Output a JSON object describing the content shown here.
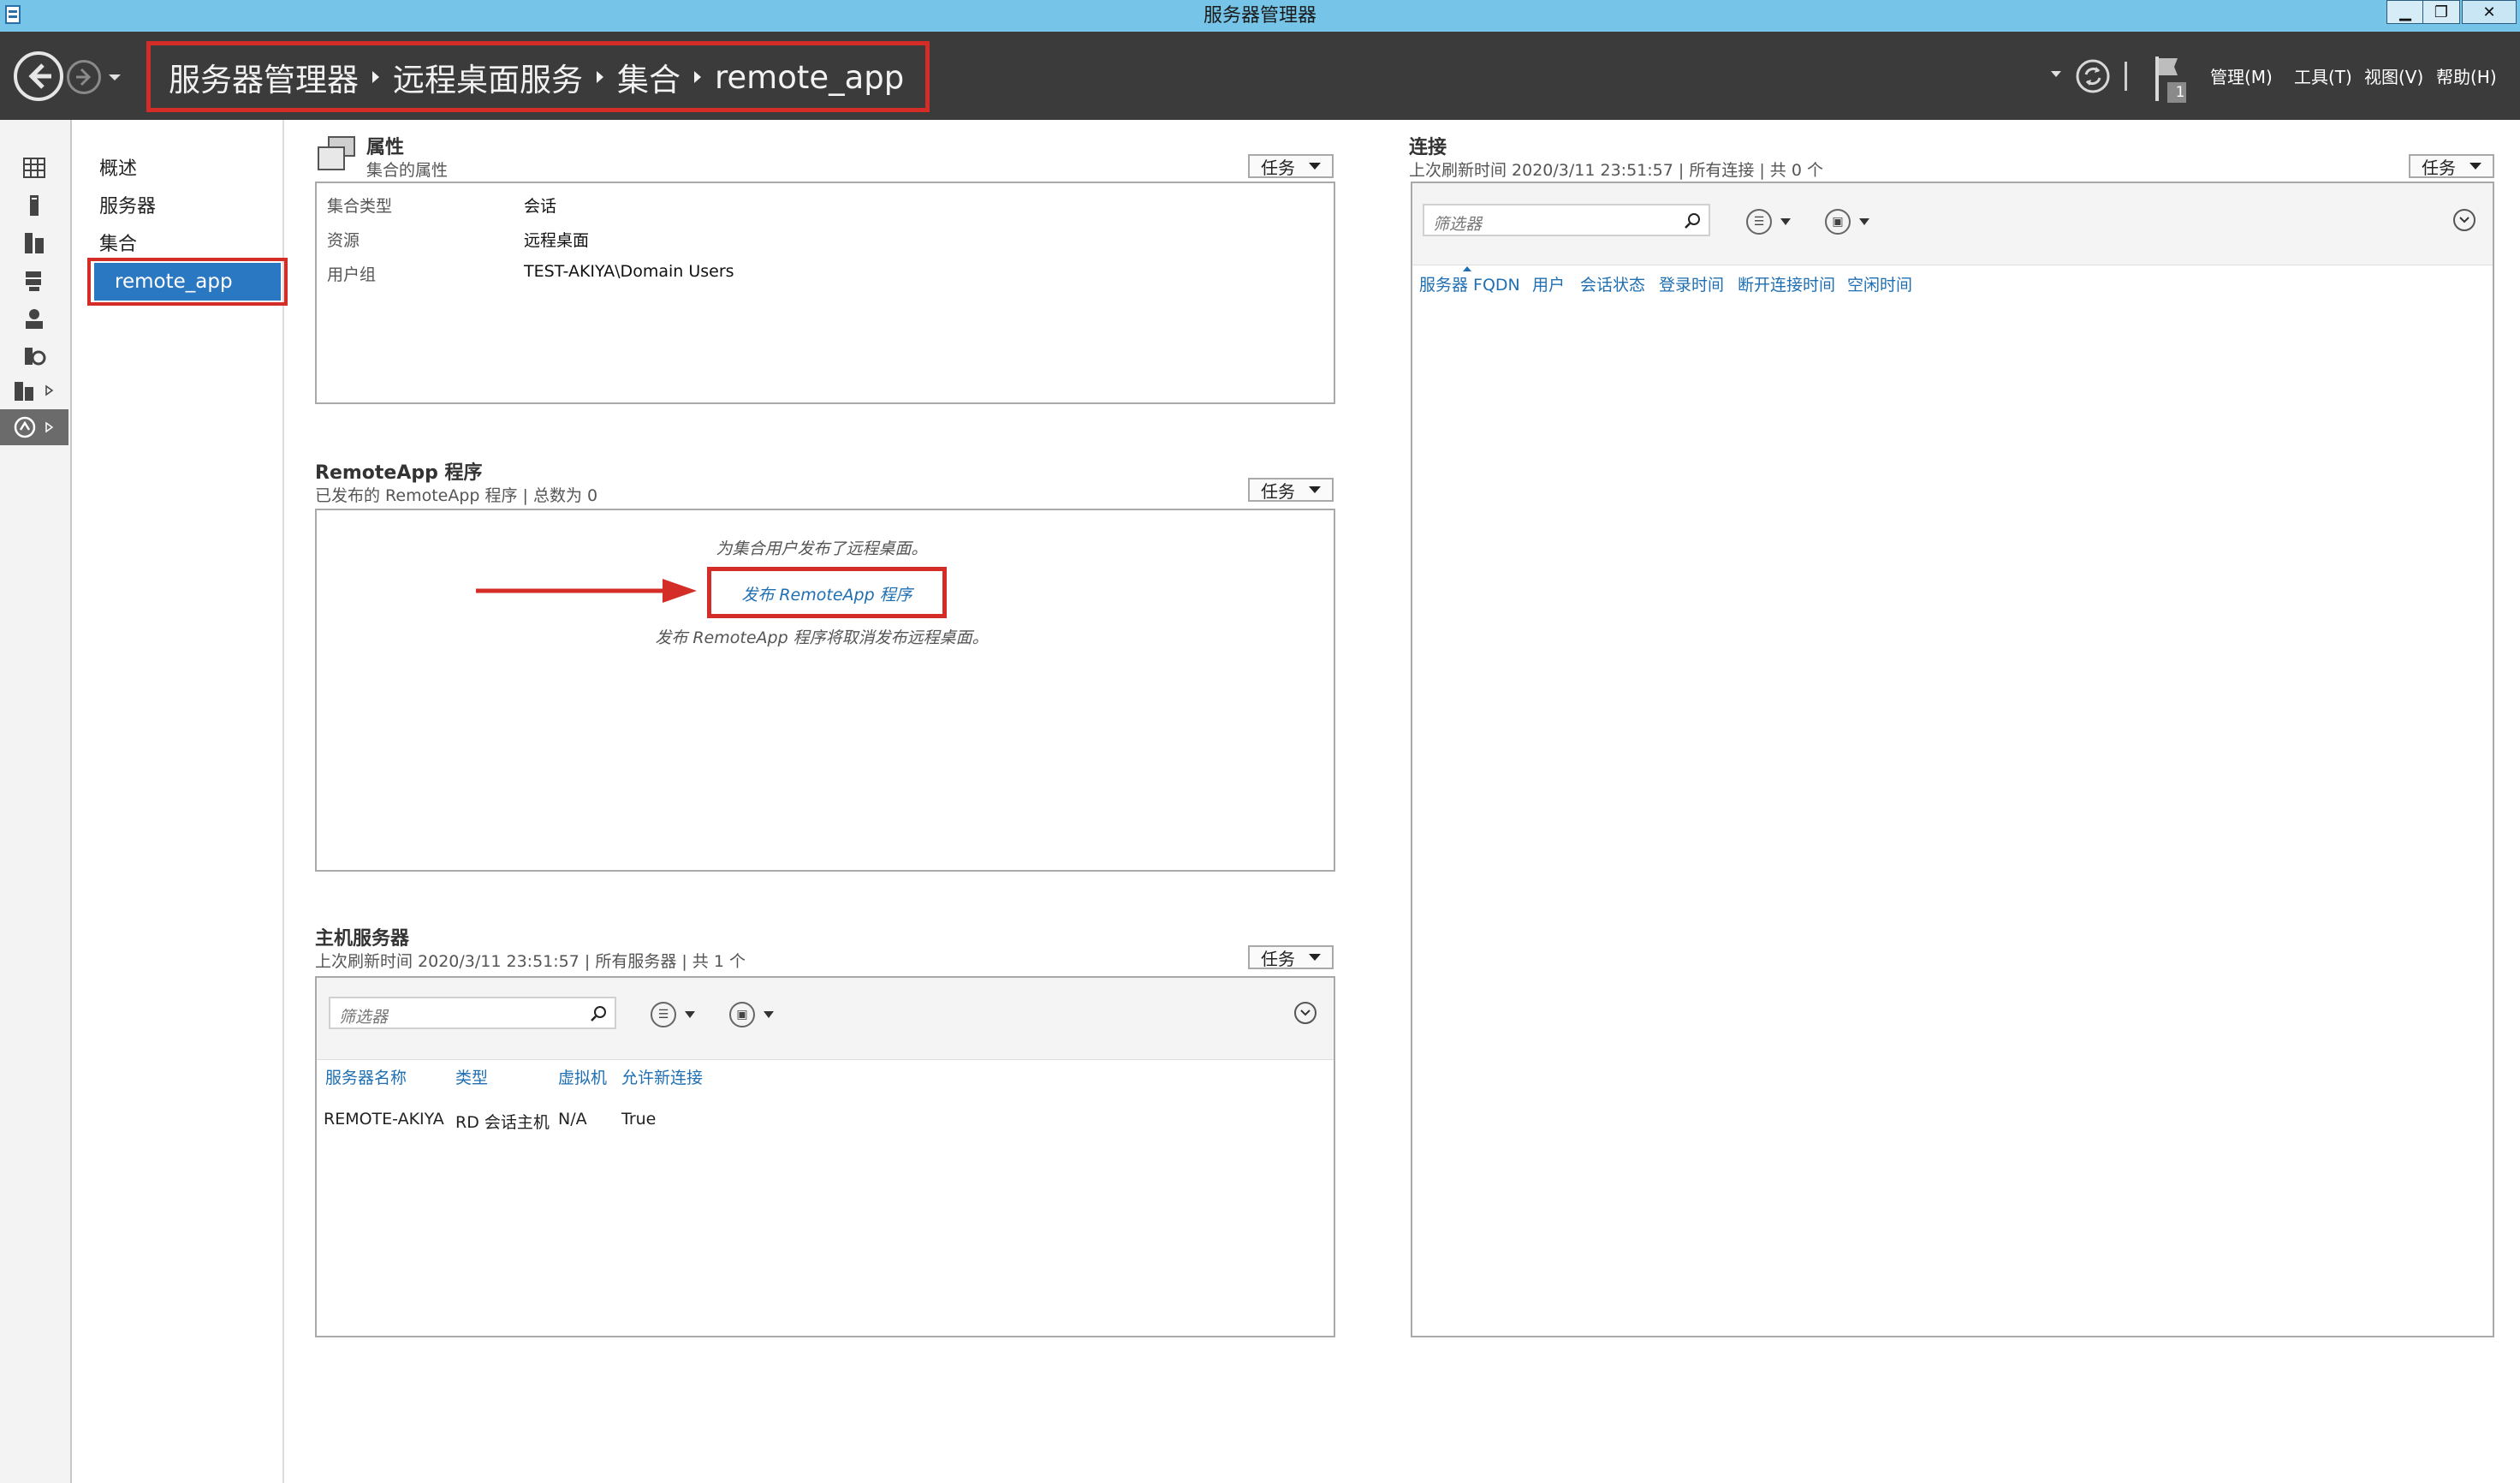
{
  "window": {
    "title": "服务器管理器"
  },
  "breadcrumb": [
    "服务器管理器",
    "远程桌面服务",
    "集合",
    "remote_app"
  ],
  "menus": [
    "管理(M)",
    "工具(T)",
    "视图(V)",
    "帮助(H)"
  ],
  "notifications": {
    "count": "1"
  },
  "rail_icons": [
    "dashboard-icon",
    "local-server-icon",
    "all-servers-icon",
    "file-storage-icon",
    "ad-icon",
    "iis-icon",
    "rds-group-icon",
    "remote-desktop-icon"
  ],
  "subnav": {
    "items": [
      "概述",
      "服务器",
      "集合"
    ],
    "selected": "remote_app"
  },
  "properties": {
    "title": "属性",
    "subtitle": "集合的属性",
    "task_label": "任务",
    "rows": [
      {
        "label": "集合类型",
        "value": "会话"
      },
      {
        "label": "资源",
        "value": "远程桌面"
      },
      {
        "label": "用户组",
        "value": "TEST-AKIYA\\Domain Users"
      }
    ]
  },
  "remoteapp": {
    "title": "RemoteApp 程序",
    "subtitle": "已发布的 RemoteApp 程序 | 总数为 0",
    "task_label": "任务",
    "note_top": "为集合用户发布了远程桌面。",
    "publish_link": "发布 RemoteApp 程序",
    "note_bottom": "发布 RemoteApp 程序将取消发布远程桌面。"
  },
  "host_servers": {
    "title": "主机服务器",
    "subtitle": "上次刷新时间 2020/3/11 23:51:57 | 所有服务器 | 共 1 个",
    "task_label": "任务",
    "filter_placeholder": "筛选器",
    "columns": [
      "服务器名称",
      "类型",
      "虚拟机",
      "允许新连接"
    ],
    "rows": [
      [
        "REMOTE-AKIYA",
        "RD 会话主机",
        "N/A",
        "True"
      ]
    ]
  },
  "connections": {
    "title": "连接",
    "subtitle": "上次刷新时间 2020/3/11 23:51:57 | 所有连接 | 共 0 个",
    "task_label": "任务",
    "filter_placeholder": "筛选器",
    "columns": [
      "服务器 FQDN",
      "用户",
      "会话状态",
      "登录时间",
      "断开连接时间",
      "空闲时间"
    ]
  },
  "colors": {
    "title_bar": "#76c5e8",
    "nav_bar": "#3b3b3b",
    "highlight_red": "#d42d27",
    "selection_blue": "#2b78c2",
    "link_blue": "#1f6fb2"
  }
}
